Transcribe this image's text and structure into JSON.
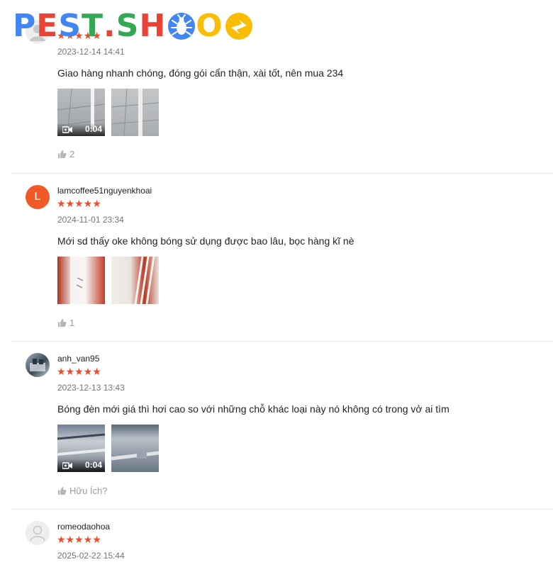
{
  "logo": {
    "letters": [
      {
        "ch": "P",
        "color": "#4285F4"
      },
      {
        "ch": "E",
        "color": "#EA4335"
      },
      {
        "ch": "S",
        "color": "#4285F4"
      },
      {
        "ch": "T",
        "color": "#34A853"
      },
      {
        "ch": ".",
        "color": "#EA4335"
      },
      {
        "ch": "S",
        "color": "#34A853"
      },
      {
        "ch": "H",
        "color": "#EA4335"
      },
      {
        "ch": "O",
        "color": "#FBBC05"
      }
    ],
    "bug_color": "#4285F4",
    "spark_color": "#FBBC05"
  },
  "colors": {
    "star": "#ee4d2d",
    "muted": "#757575",
    "like": "#9b9b9b"
  },
  "reviews": [
    {
      "stars": "★★★★★",
      "date": "2023-12-14 14:41",
      "text": "Giao hàng nhanh chóng, đóng gói cẩn thận, xài tốt, nên mua 234",
      "media": [
        {
          "video": true,
          "duration": "0:04"
        },
        {
          "video": false
        }
      ],
      "likes": "2"
    },
    {
      "avatar_letter": "L",
      "username": "lamcoffee51nguyenkhoai",
      "stars": "★★★★★",
      "date": "2024-11-01 23:34",
      "text": "Mới sd thấy oke không bóng sử dụng được bao lâu, bọc hàng kĩ nè",
      "media": [
        {
          "video": false
        },
        {
          "video": false
        }
      ],
      "likes": "1"
    },
    {
      "username": "anh_van95",
      "stars": "★★★★★",
      "date": "2023-12-13 13:43",
      "text": "Bóng đèn mới giá thì hơi cao so với những chỗ khác loại này nó không có trong vở ai tìm",
      "media": [
        {
          "video": true,
          "duration": "0:04"
        },
        {
          "video": false
        }
      ],
      "likes": "Hữu Ích?"
    },
    {
      "username": "romeodaohoa",
      "stars": "★★★★★",
      "date": "2025-02-22 15:44"
    }
  ]
}
